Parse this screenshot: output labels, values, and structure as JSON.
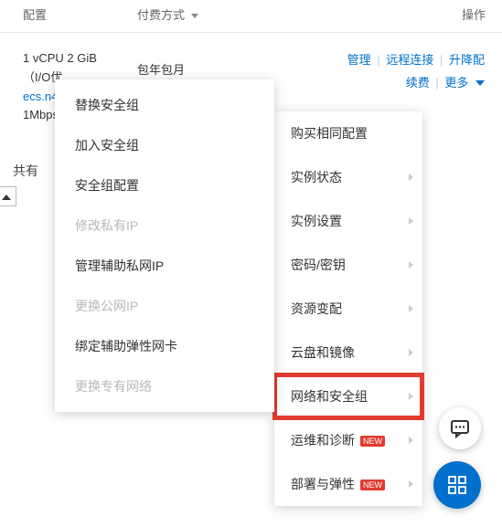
{
  "header": {
    "config": "配置",
    "payment": "付费方式",
    "ops": "操作"
  },
  "instance": {
    "spec_line1": "1 vCPU 2 GiB",
    "spec_line2_prefix": "（I/O优",
    "type": "ecs.n4",
    "bandwidth": "1Mbps",
    "payment": "包年包月",
    "ops_manage": "管理",
    "ops_remote": "远程连接",
    "ops_scale": "升降配",
    "ops_renew": "续费",
    "ops_more": "更多"
  },
  "share_label": "共有",
  "main_menu": {
    "items": [
      {
        "label": "购买相同配置",
        "has_sub": false
      },
      {
        "label": "实例状态",
        "has_sub": true
      },
      {
        "label": "实例设置",
        "has_sub": true
      },
      {
        "label": "密码/密钥",
        "has_sub": true
      },
      {
        "label": "资源变配",
        "has_sub": true
      },
      {
        "label": "云盘和镜像",
        "has_sub": true
      },
      {
        "label": "网络和安全组",
        "has_sub": true,
        "highlighted": true
      },
      {
        "label": "运维和诊断",
        "has_sub": true,
        "new": true
      },
      {
        "label": "部署与弹性",
        "has_sub": true,
        "new": true
      }
    ]
  },
  "submenu": {
    "items": [
      {
        "label": "替换安全组"
      },
      {
        "label": "加入安全组"
      },
      {
        "label": "安全组配置"
      },
      {
        "label": "修改私有IP",
        "disabled": true
      },
      {
        "label": "管理辅助私网IP"
      },
      {
        "label": "更换公网IP",
        "disabled": true
      },
      {
        "label": "绑定辅助弹性网卡"
      },
      {
        "label": "更换专有网络",
        "disabled": true
      }
    ]
  },
  "new_badge_text": "NEW"
}
